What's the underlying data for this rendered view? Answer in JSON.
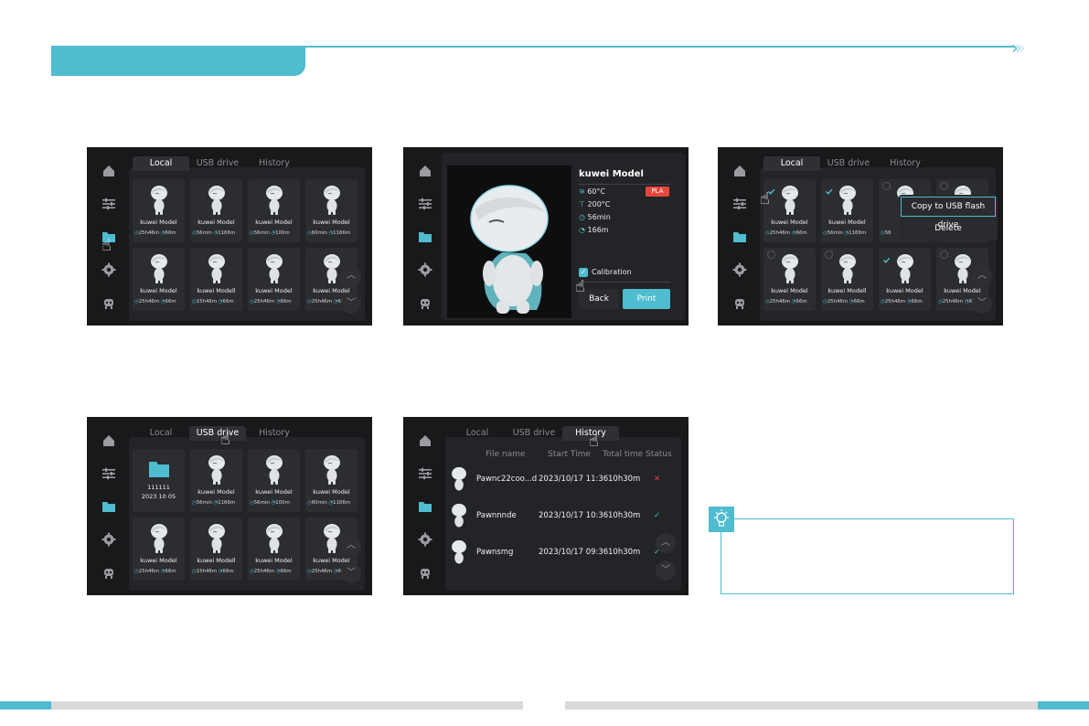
{
  "screens": {
    "local": {
      "tabs": [
        "Local",
        "USB drive",
        "History"
      ],
      "cards": [
        {
          "name": "kuwei Model",
          "time": "25h46m",
          "len": "66m"
        },
        {
          "name": "kuwei  Model",
          "time": "56min",
          "len": "1166m"
        },
        {
          "name": "kuwei  Model",
          "time": "56min",
          "len": "100m"
        },
        {
          "name": "kuwei  Model",
          "time": "60min",
          "len": "1166m"
        },
        {
          "name": "kuwei Model",
          "time": "25h46m",
          "len": "66m"
        },
        {
          "name": "kuwei Modell",
          "time": "15h46m",
          "len": "66m"
        },
        {
          "name": "kuwei Model",
          "time": "25h46m",
          "len": "66m"
        },
        {
          "name": "kuwei Model",
          "time": "25h46m",
          "len": "66m"
        }
      ]
    },
    "detail": {
      "title": "kuwei Model",
      "bed": "60°C",
      "nozzle": "200°C",
      "time": "56min",
      "length": "166m",
      "material": "PLA",
      "calibration": "Calibration",
      "back": "Back",
      "print": "Print"
    },
    "select": {
      "tabs": [
        "Local",
        "USB drive",
        "History"
      ],
      "menu_copy": "Copy to USB flash drive",
      "menu_delete": "Delete",
      "cards": [
        {
          "name": "kuwei Model",
          "time": "25h46m",
          "len": "66m"
        },
        {
          "name": "kuwei  Model",
          "time": "56min",
          "len": "1166m"
        },
        {
          "name": "ku",
          "time": "56",
          "len": ""
        },
        {
          "name": "",
          "time": "",
          "len": ""
        },
        {
          "name": "kuwei Model",
          "time": "25h46m",
          "len": "66m"
        },
        {
          "name": "kuwei Modell",
          "time": "25h46m",
          "len": "66m"
        },
        {
          "name": "kuwei Model",
          "time": "25h46m",
          "len": "66m"
        },
        {
          "name": "kuwei Model",
          "time": "25h46m",
          "len": "66m"
        }
      ]
    },
    "usb": {
      "tabs": [
        "Local",
        "USB drive",
        "History"
      ],
      "folder_name": "111111",
      "folder_date": "2023 10 05",
      "cards": [
        {
          "name": "kuwei  Model",
          "time": "56min",
          "len": "1166m"
        },
        {
          "name": "kuwei  Model",
          "time": "56min",
          "len": "100m"
        },
        {
          "name": "kuwei  Model",
          "time": "60min",
          "len": "1166m"
        },
        {
          "name": "kuwei Model",
          "time": "25h46m",
          "len": "66m"
        },
        {
          "name": "kuwei Modell",
          "time": "15h46m",
          "len": "66m"
        },
        {
          "name": "kuwei Model",
          "time": "25h46m",
          "len": "66m"
        },
        {
          "name": "kuwei Model",
          "time": "25h46m",
          "len": "66m"
        }
      ]
    },
    "history": {
      "tabs": [
        "Local",
        "USB drive",
        "History"
      ],
      "headers": [
        "File name",
        "Start Time",
        "Total time",
        "Status"
      ],
      "rows": [
        {
          "file": "Pawnc22coo...d",
          "start": "2023/10/17 11:36",
          "total": "10h30m",
          "status": "✕",
          "ok": false
        },
        {
          "file": "Pawnnnde",
          "start": "2023/10/17 10:36",
          "total": "10h30m",
          "status": "✓",
          "ok": true
        },
        {
          "file": "Pawnsmg",
          "start": "2023/10/17 09:36",
          "total": "10h30m",
          "status": "✓",
          "ok": true
        }
      ]
    }
  },
  "colors": {
    "accent": "#4fbcd0",
    "error": "#e0435a",
    "pla": "#e8453c"
  },
  "icons": [
    "home-icon",
    "sliders-icon",
    "folder-icon",
    "gear-icon",
    "robot-icon",
    "clock-icon",
    "filament-icon",
    "lightbulb-icon",
    "chevron-up-icon",
    "chevron-down-icon",
    "hand-pointer-icon"
  ]
}
